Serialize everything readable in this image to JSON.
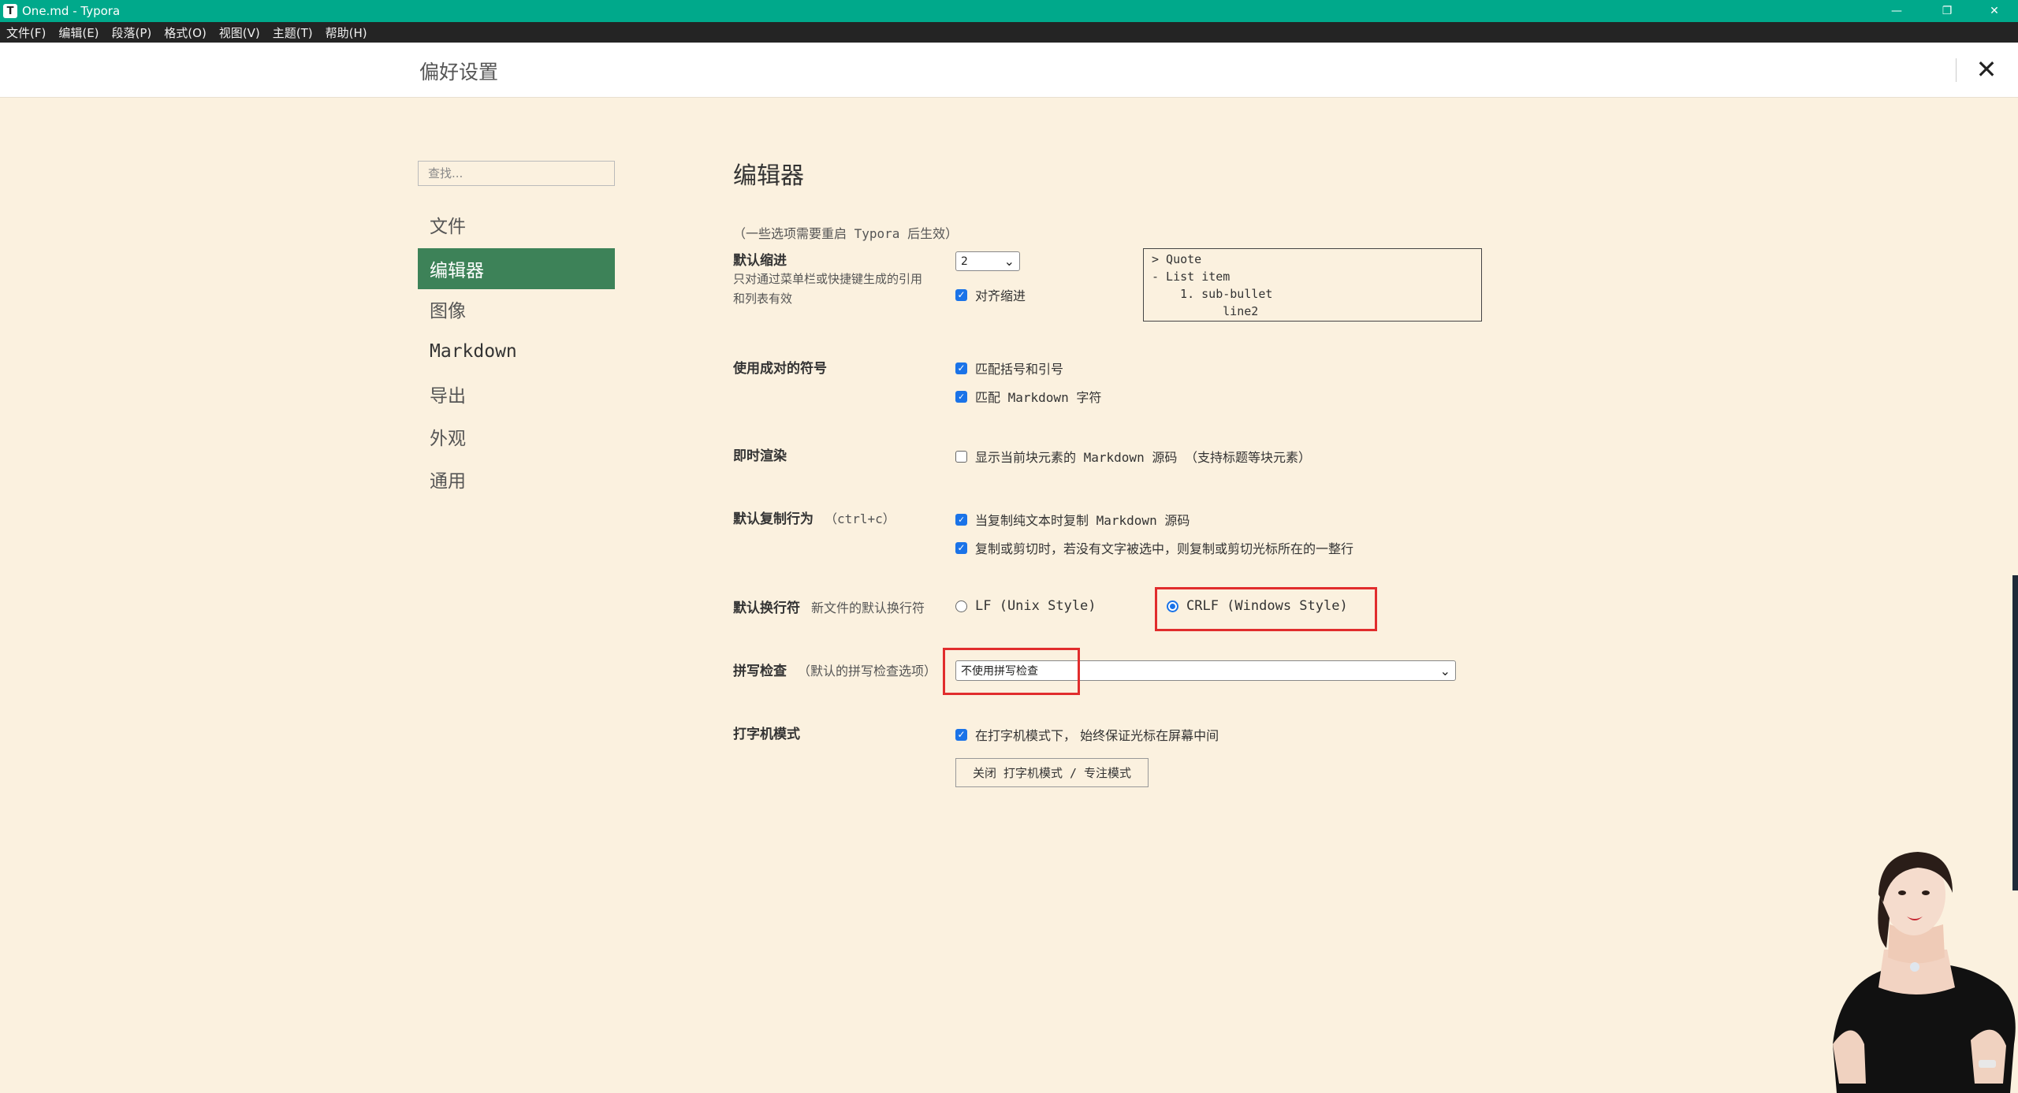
{
  "window": {
    "title": "One.md - Typora",
    "app_icon": "T"
  },
  "menubar": [
    "文件(F)",
    "编辑(E)",
    "段落(P)",
    "格式(O)",
    "视图(V)",
    "主题(T)",
    "帮助(H)"
  ],
  "prefs": {
    "title": "偏好设置"
  },
  "sidebar": {
    "search_placeholder": "查找...",
    "items": [
      "文件",
      "编辑器",
      "图像",
      "Markdown",
      "导出",
      "外观",
      "通用"
    ],
    "active_index": 1
  },
  "editor": {
    "title": "编辑器",
    "restart_note": "（一些选项需要重启 Typora 后生效）",
    "indent": {
      "label": "默认缩进",
      "description": "只对通过菜单栏或快捷键生成的引用和列表有效",
      "value": "2",
      "align_label": "对齐缩进",
      "align_checked": true,
      "preview_lines": [
        "> Quote",
        "- List item",
        "  1. sub-bullet",
        "     line2"
      ]
    },
    "pair": {
      "label": "使用成对的符号",
      "options": [
        {
          "label": "匹配括号和引号",
          "checked": true
        },
        {
          "label": "匹配 Markdown 字符",
          "checked": true
        }
      ]
    },
    "live": {
      "label": "即时渲染",
      "option": {
        "label": "显示当前块元素的 Markdown 源码 （支持标题等块元素）",
        "checked": false
      }
    },
    "copy": {
      "label": "默认复制行为",
      "sublabel": "（ctrl+c）",
      "options": [
        {
          "label": "当复制纯文本时复制 Markdown 源码",
          "checked": true
        },
        {
          "label": "复制或剪切时，若没有文字被选中，则复制或剪切光标所在的一整行",
          "checked": true
        }
      ]
    },
    "newline": {
      "label": "默认换行符",
      "sublabel": "新文件的默认换行符",
      "lf": "LF (Unix Style)",
      "crlf": "CRLF (Windows Style)",
      "selected": "crlf"
    },
    "spell": {
      "label": "拼写检查",
      "sublabel": "（默认的拼写检查选项）",
      "value": "不使用拼写检查"
    },
    "typewriter": {
      "label": "打字机模式",
      "option": {
        "label": "在打字机模式下， 始终保证光标在屏幕中间",
        "checked": true
      },
      "button": "关闭 打字机模式 / 专注模式"
    }
  },
  "colors": {
    "titlebar": "#00a98b",
    "menubar": "#242424",
    "background": "#fbf1df",
    "active_nav": "#3d8258",
    "checkbox": "#1a73e8",
    "highlight": "#e12d2d"
  }
}
